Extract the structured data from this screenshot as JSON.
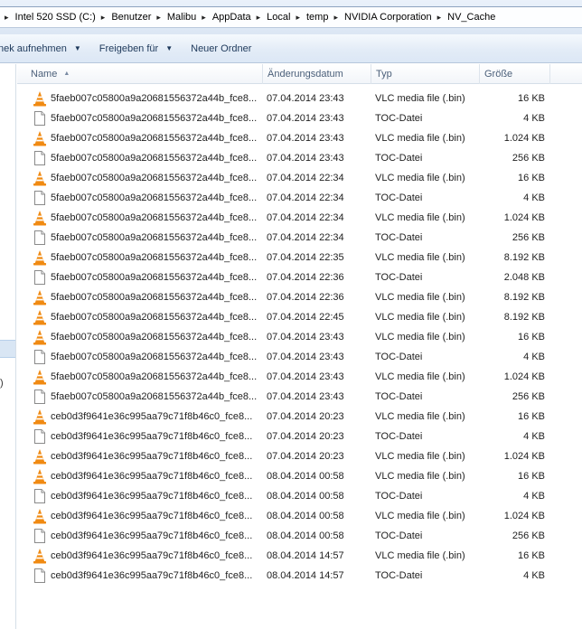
{
  "breadcrumb": {
    "items": [
      "Intel 520 SSD (C:)",
      "Benutzer",
      "Malibu",
      "AppData",
      "Local",
      "temp",
      "NVIDIA Corporation",
      "NV_Cache"
    ],
    "separator": "▸"
  },
  "toolbar": {
    "library_label": "nek aufnehmen",
    "share_label": "Freigeben für",
    "new_folder_label": "Neuer Ordner",
    "dropdown_glyph": "▼"
  },
  "nav": {
    "fragment": ")"
  },
  "columns": {
    "name": "Name",
    "date": "Änderungsdatum",
    "type": "Typ",
    "size": "Größe"
  },
  "files": [
    {
      "name": "5faeb007c05800a9a20681556372a44b_fce8...",
      "date": "07.04.2014 23:43",
      "type": "VLC media file (.bin)",
      "size": "16 KB",
      "icon": "vlc-cone-icon"
    },
    {
      "name": "5faeb007c05800a9a20681556372a44b_fce8...",
      "date": "07.04.2014 23:43",
      "type": "TOC-Datei",
      "size": "4 KB",
      "icon": "document-icon"
    },
    {
      "name": "5faeb007c05800a9a20681556372a44b_fce8...",
      "date": "07.04.2014 23:43",
      "type": "VLC media file (.bin)",
      "size": "1.024 KB",
      "icon": "vlc-cone-icon"
    },
    {
      "name": "5faeb007c05800a9a20681556372a44b_fce8...",
      "date": "07.04.2014 23:43",
      "type": "TOC-Datei",
      "size": "256 KB",
      "icon": "document-icon"
    },
    {
      "name": "5faeb007c05800a9a20681556372a44b_fce8...",
      "date": "07.04.2014 22:34",
      "type": "VLC media file (.bin)",
      "size": "16 KB",
      "icon": "vlc-cone-icon"
    },
    {
      "name": "5faeb007c05800a9a20681556372a44b_fce8...",
      "date": "07.04.2014 22:34",
      "type": "TOC-Datei",
      "size": "4 KB",
      "icon": "document-icon"
    },
    {
      "name": "5faeb007c05800a9a20681556372a44b_fce8...",
      "date": "07.04.2014 22:34",
      "type": "VLC media file (.bin)",
      "size": "1.024 KB",
      "icon": "vlc-cone-icon"
    },
    {
      "name": "5faeb007c05800a9a20681556372a44b_fce8...",
      "date": "07.04.2014 22:34",
      "type": "TOC-Datei",
      "size": "256 KB",
      "icon": "document-icon"
    },
    {
      "name": "5faeb007c05800a9a20681556372a44b_fce8...",
      "date": "07.04.2014 22:35",
      "type": "VLC media file (.bin)",
      "size": "8.192 KB",
      "icon": "vlc-cone-icon"
    },
    {
      "name": "5faeb007c05800a9a20681556372a44b_fce8...",
      "date": "07.04.2014 22:36",
      "type": "TOC-Datei",
      "size": "2.048 KB",
      "icon": "document-icon"
    },
    {
      "name": "5faeb007c05800a9a20681556372a44b_fce8...",
      "date": "07.04.2014 22:36",
      "type": "VLC media file (.bin)",
      "size": "8.192 KB",
      "icon": "vlc-cone-icon"
    },
    {
      "name": "5faeb007c05800a9a20681556372a44b_fce8...",
      "date": "07.04.2014 22:45",
      "type": "VLC media file (.bin)",
      "size": "8.192 KB",
      "icon": "vlc-cone-icon"
    },
    {
      "name": "5faeb007c05800a9a20681556372a44b_fce8...",
      "date": "07.04.2014 23:43",
      "type": "VLC media file (.bin)",
      "size": "16 KB",
      "icon": "vlc-cone-icon"
    },
    {
      "name": "5faeb007c05800a9a20681556372a44b_fce8...",
      "date": "07.04.2014 23:43",
      "type": "TOC-Datei",
      "size": "4 KB",
      "icon": "document-icon"
    },
    {
      "name": "5faeb007c05800a9a20681556372a44b_fce8...",
      "date": "07.04.2014 23:43",
      "type": "VLC media file (.bin)",
      "size": "1.024 KB",
      "icon": "vlc-cone-icon"
    },
    {
      "name": "5faeb007c05800a9a20681556372a44b_fce8...",
      "date": "07.04.2014 23:43",
      "type": "TOC-Datei",
      "size": "256 KB",
      "icon": "document-icon"
    },
    {
      "name": "ceb0d3f9641e36c995aa79c71f8b46c0_fce8...",
      "date": "07.04.2014 20:23",
      "type": "VLC media file (.bin)",
      "size": "16 KB",
      "icon": "vlc-cone-icon"
    },
    {
      "name": "ceb0d3f9641e36c995aa79c71f8b46c0_fce8...",
      "date": "07.04.2014 20:23",
      "type": "TOC-Datei",
      "size": "4 KB",
      "icon": "document-icon"
    },
    {
      "name": "ceb0d3f9641e36c995aa79c71f8b46c0_fce8...",
      "date": "07.04.2014 20:23",
      "type": "VLC media file (.bin)",
      "size": "1.024 KB",
      "icon": "vlc-cone-icon"
    },
    {
      "name": "ceb0d3f9641e36c995aa79c71f8b46c0_fce8...",
      "date": "08.04.2014 00:58",
      "type": "VLC media file (.bin)",
      "size": "16 KB",
      "icon": "vlc-cone-icon"
    },
    {
      "name": "ceb0d3f9641e36c995aa79c71f8b46c0_fce8...",
      "date": "08.04.2014 00:58",
      "type": "TOC-Datei",
      "size": "4 KB",
      "icon": "document-icon"
    },
    {
      "name": "ceb0d3f9641e36c995aa79c71f8b46c0_fce8...",
      "date": "08.04.2014 00:58",
      "type": "VLC media file (.bin)",
      "size": "1.024 KB",
      "icon": "vlc-cone-icon"
    },
    {
      "name": "ceb0d3f9641e36c995aa79c71f8b46c0_fce8...",
      "date": "08.04.2014 00:58",
      "type": "TOC-Datei",
      "size": "256 KB",
      "icon": "document-icon"
    },
    {
      "name": "ceb0d3f9641e36c995aa79c71f8b46c0_fce8...",
      "date": "08.04.2014 14:57",
      "type": "VLC media file (.bin)",
      "size": "16 KB",
      "icon": "vlc-cone-icon"
    },
    {
      "name": "ceb0d3f9641e36c995aa79c71f8b46c0_fce8...",
      "date": "08.04.2014 14:57",
      "type": "TOC-Datei",
      "size": "4 KB",
      "icon": "document-icon"
    }
  ],
  "colors": {
    "vlc_orange": "#f08a12",
    "vlc_stripe": "#ffffff",
    "header_text": "#4c607a",
    "toolbar_text": "#1e395b"
  }
}
